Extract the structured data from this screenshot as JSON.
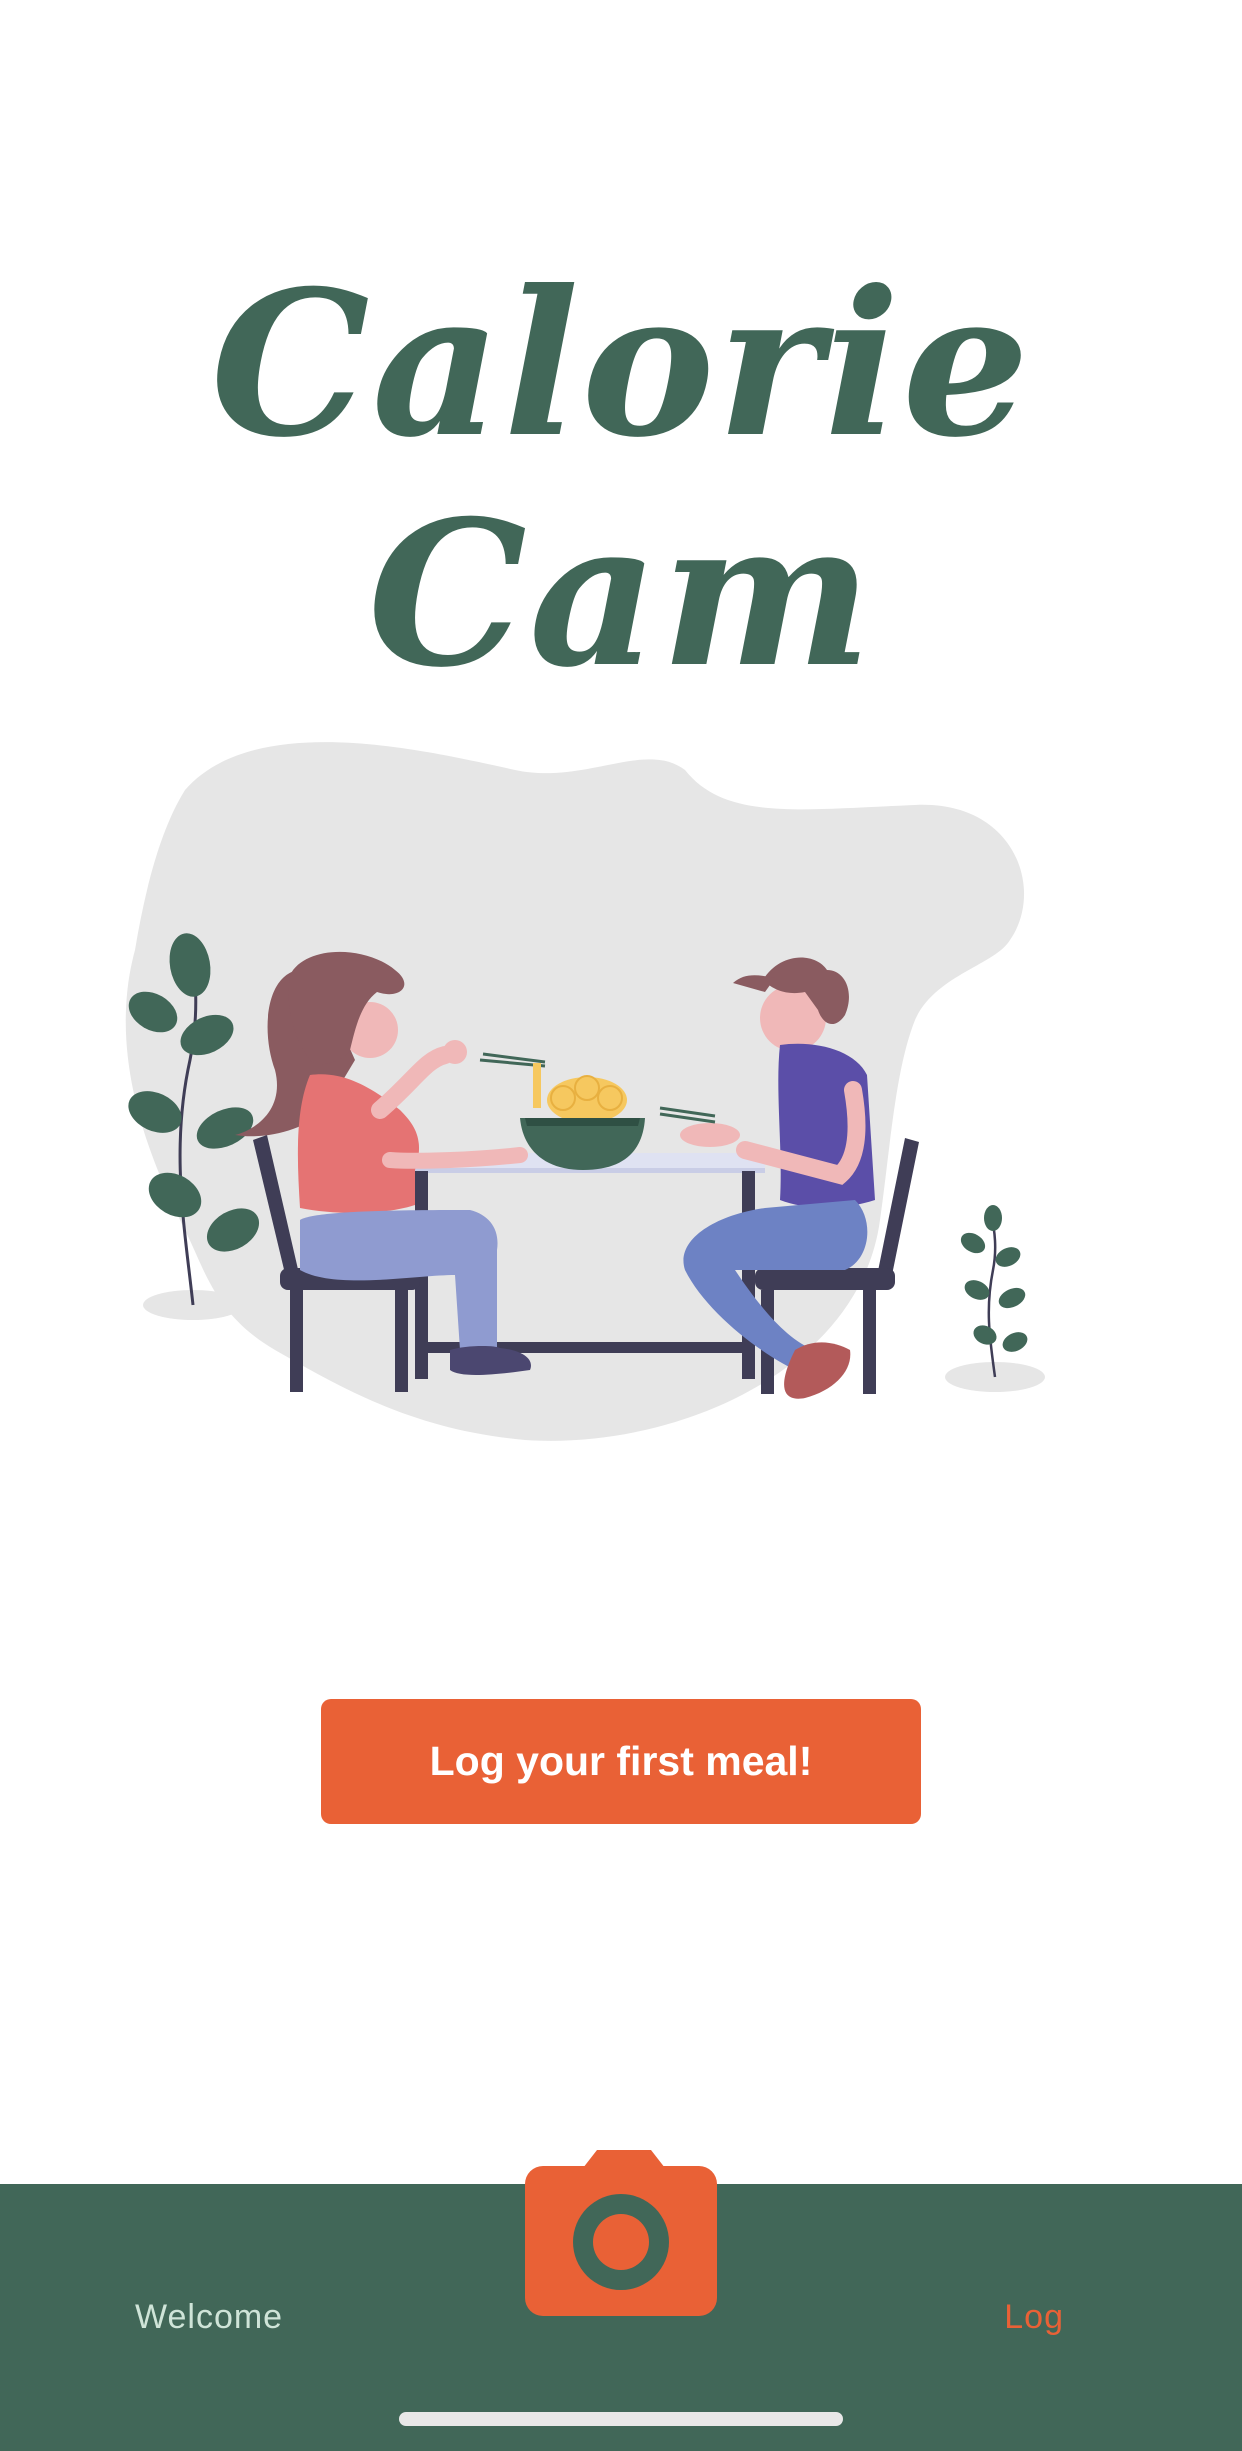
{
  "app": {
    "title": "Calorie Cam"
  },
  "illustration": {
    "name": "couple-dining-noodles"
  },
  "cta": {
    "label": "Log your first meal!"
  },
  "tabbar": {
    "items": [
      {
        "label": "Welcome",
        "active": false
      },
      {
        "icon": "camera-icon"
      },
      {
        "label": "Log",
        "active": true
      }
    ]
  },
  "colors": {
    "brand_green": "#416758",
    "accent_orange": "#e96136",
    "blob_gray": "#e6e6e6",
    "inactive_tab": "#cfe4d8"
  }
}
